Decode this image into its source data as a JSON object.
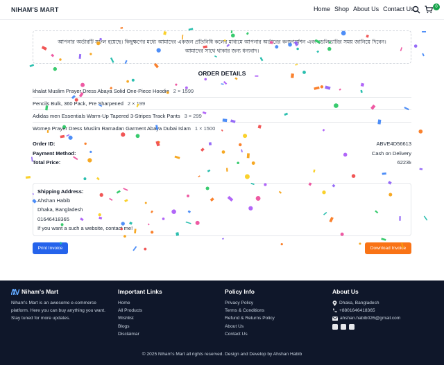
{
  "header": {
    "brand": "NIHAM'S MART",
    "nav": [
      "Home",
      "Shop",
      "About Us",
      "Contact Us"
    ],
    "cart_count": "0"
  },
  "notice": {
    "line1": "আপনার অর্ডারটি সফল হয়েছে। কিছুক্ষণের মধ্যে আমাদের একজন প্রতিনিধি কলের মাধ্যমে আপনার অর্ডারের কনফার্মেশন এবং ডেলিভারির সময় জানিয়ে দিবেন।",
    "line2": "আমাদের সাথে থাকার জন্য ধন্যবাদ।"
  },
  "order": {
    "title": "ORDER DETAILS",
    "items": [
      {
        "name": "khalat Muslim Prayer Dress Abaya Solid One-Piece Hoodie",
        "qty": "2 × 1599"
      },
      {
        "name": "Pencils Bulk, 360 Pack, Pre Sharpened",
        "qty": "2 × 199"
      },
      {
        "name": "Adidas men Essentials Warm-Up Tapered 3-Stripes Track Pants",
        "qty": "3 × 299"
      },
      {
        "name": "Women Prayer Dress Muslim Ramadan Garment Abaya Dubai Islam",
        "qty": "1 × 1500"
      }
    ],
    "order_id_label": "Order ID:",
    "order_id": "ABVE4D56613",
    "payment_label": "Payment Method:",
    "payment": "Cash on Delivery",
    "total_label": "Total Price:",
    "total": "6223৳"
  },
  "shipping": {
    "label": "Shipping Address:",
    "name": "Ahshan Habib",
    "city": "Dhaka, Bangladesh",
    "phone": "01646418365",
    "note": "If you want a such a website, contact me!"
  },
  "buttons": {
    "print": "Print Invoice",
    "download": "Download Invoice"
  },
  "footer": {
    "brand": "Niham's Mart",
    "about": "Niham's Mart is an awesome e-commerce platform. Here you can buy anything you want. Stay tuned for more updates.",
    "links_title": "Important Links",
    "links": [
      "Home",
      "All Products",
      "Wishlist",
      "Blogs",
      "Disclaimar"
    ],
    "policy_title": "Policy Info",
    "policy": [
      "Privacy Policy",
      "Terms & Conditions",
      "Refund & Returns Policy",
      "About Us",
      "Contact Us"
    ],
    "about_title": "About Us",
    "location": "Dhaka, Bangladesh",
    "phone": "+8801646418365",
    "email": "ahshan.habib026@gmail.com",
    "copyright": "© 2025 Niham's Mart all rights reserved. Design and Develop by Ahshan Habib"
  },
  "colors": {
    "accent_blue": "#2563eb",
    "accent_orange": "#f97316",
    "footer_bg": "#0f172a",
    "badge": "#16a34a"
  }
}
